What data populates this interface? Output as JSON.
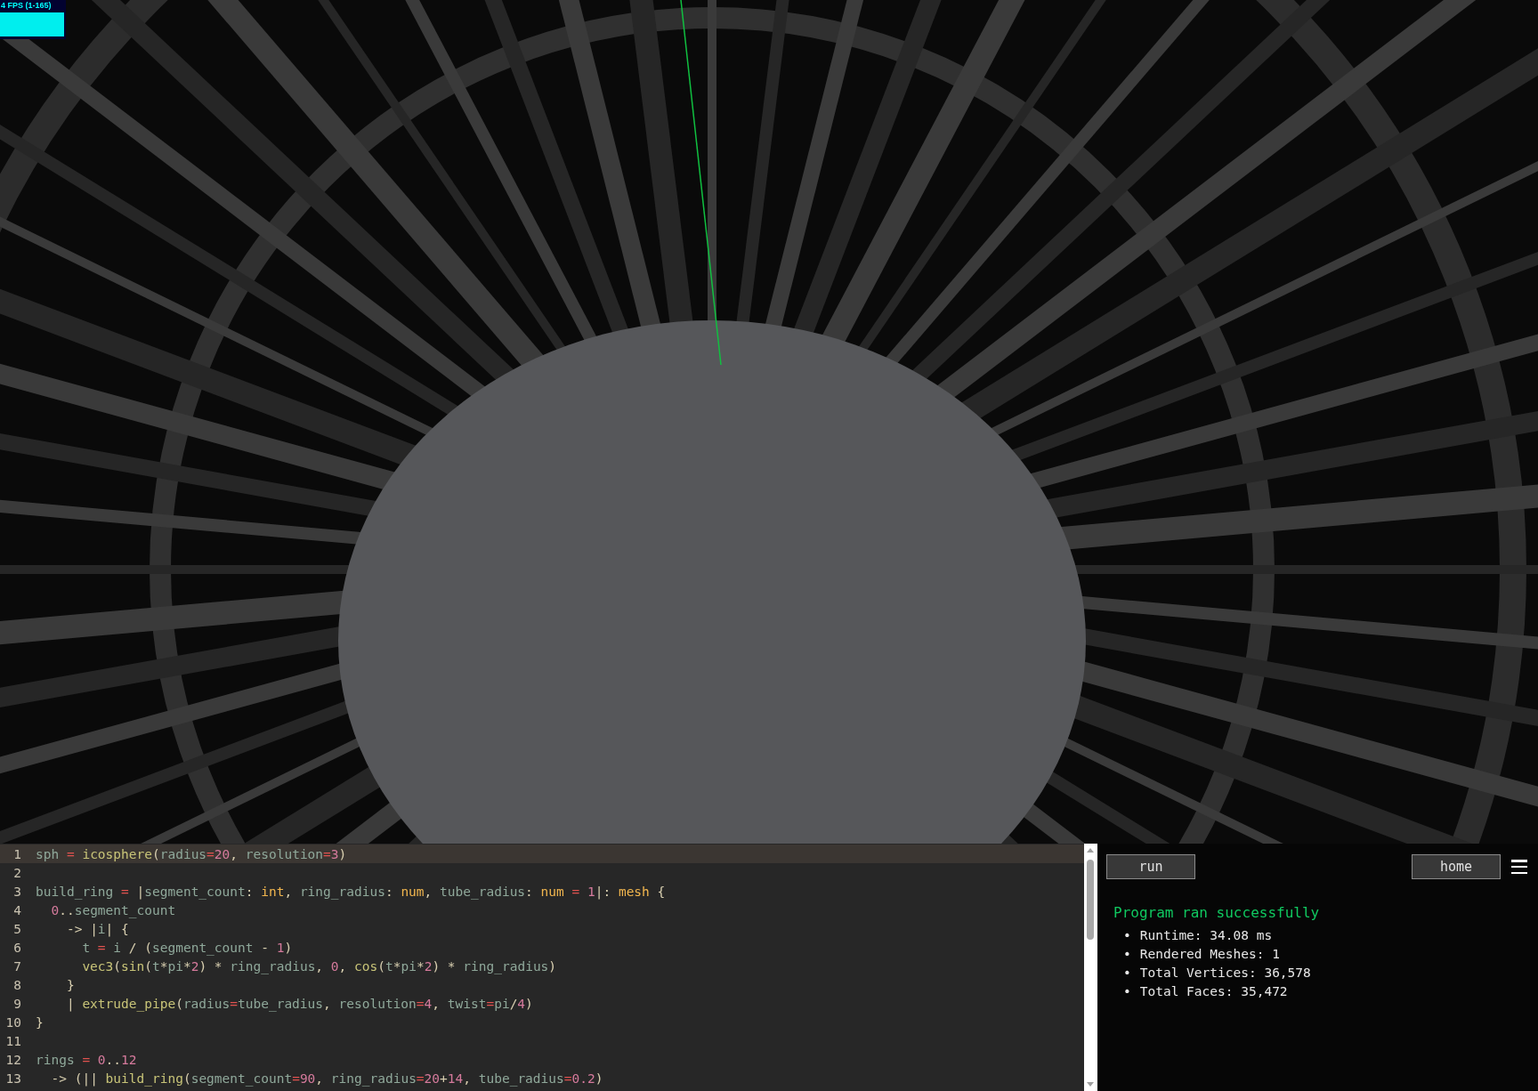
{
  "fps_meter": {
    "label": "4 FPS (1-165)"
  },
  "editor": {
    "lines": [
      {
        "number": "1",
        "current": true,
        "code": "sph = icosphere(radius=20, resolution=3)"
      },
      {
        "number": "2",
        "current": false
      },
      {
        "number": "3",
        "current": false,
        "code": "build_ring = |segment_count: int, ring_radius: num, tube_radius: num = 1|: mesh {"
      },
      {
        "number": "4",
        "current": false,
        "code": "  0..segment_count"
      },
      {
        "number": "5",
        "current": false,
        "code": "    -> |i| {"
      },
      {
        "number": "6",
        "current": false,
        "code": "      t = i / (segment_count - 1)"
      },
      {
        "number": "7",
        "current": false,
        "code": "      vec3(sin(t*pi*2) * ring_radius, 0, cos(t*pi*2) * ring_radius)"
      },
      {
        "number": "8",
        "current": false,
        "code": "    }"
      },
      {
        "number": "9",
        "current": false,
        "code": "    | extrude_pipe(radius=tube_radius, resolution=4, twist=pi/4)"
      },
      {
        "number": "10",
        "current": false,
        "code": "}"
      },
      {
        "number": "11",
        "current": false
      },
      {
        "number": "12",
        "current": false,
        "code": "rings = 0..12"
      },
      {
        "number": "13",
        "current": false,
        "code": "  -> (|| build_ring(segment_count=90, ring_radius=20+14, tube_radius=0.2)"
      }
    ]
  },
  "panel": {
    "run_button": "run",
    "home_button": "home",
    "status": "Program ran successfully",
    "stats": [
      {
        "marker": "•",
        "text": "Runtime: 34.08 ms"
      },
      {
        "marker": "•",
        "text": "Rendered Meshes: 1"
      },
      {
        "marker": "•",
        "text": "Total Vertices: 36,578"
      },
      {
        "marker": "•",
        "text": "Total Faces: 35,472"
      }
    ]
  }
}
